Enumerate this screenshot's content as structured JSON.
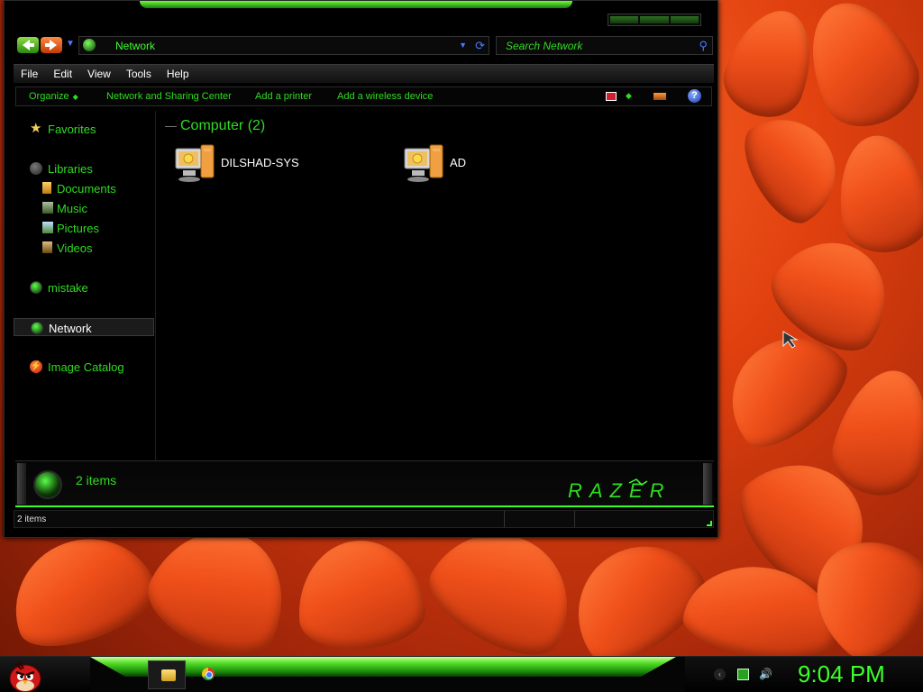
{
  "window": {
    "address": "Network",
    "search_placeholder": "Search Network"
  },
  "menu": [
    "File",
    "Edit",
    "View",
    "Tools",
    "Help"
  ],
  "command_bar": {
    "organize": "Organize",
    "network_sharing": "Network and Sharing Center",
    "add_printer": "Add a printer",
    "add_wireless": "Add a wireless device"
  },
  "nav_pane": {
    "favorites": "Favorites",
    "libraries": "Libraries",
    "documents": "Documents",
    "music": "Music",
    "pictures": "Pictures",
    "videos": "Videos",
    "homegroup": "mistake",
    "network": "Network",
    "image_catalog": "Image Catalog"
  },
  "content": {
    "group_title": "Computer (2)",
    "computers": [
      "DILSHAD-SYS",
      "AD"
    ]
  },
  "details": {
    "count": "2 items",
    "logo": "RAZER"
  },
  "status_bar": {
    "text": "2 items"
  },
  "taskbar": {
    "clock": "9:04 PM",
    "apps": [
      "windows-explorer",
      "google-chrome"
    ]
  },
  "colors": {
    "accent_green": "#2fdc20",
    "window_bg": "#000000",
    "wallpaper_orange": "#e0400e"
  }
}
